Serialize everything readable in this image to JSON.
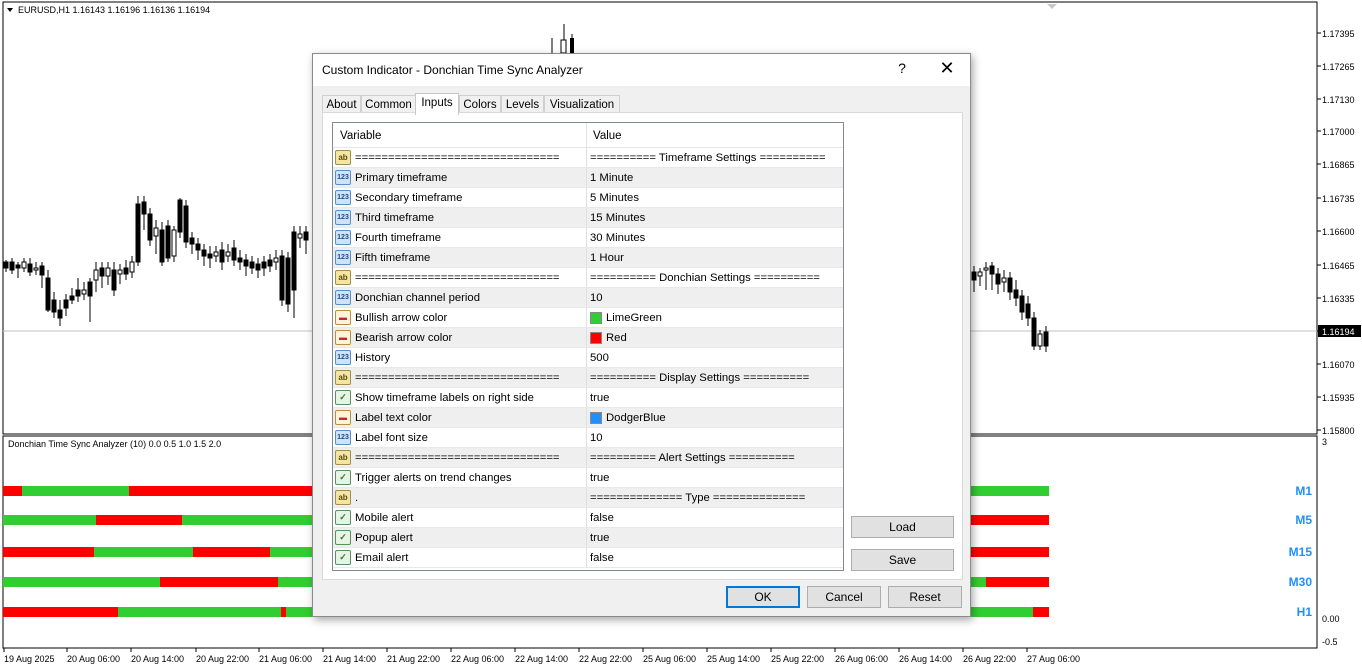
{
  "chart": {
    "symbol_info": "EURUSD,H1  1.16143 1.16196 1.16136 1.16194",
    "price_labels": [
      "1.17395",
      "1.17265",
      "1.17130",
      "1.17000",
      "1.16865",
      "1.16735",
      "1.16600",
      "1.16465",
      "1.16335",
      "1.16194",
      "1.16070",
      "1.15935",
      "1.15800"
    ],
    "current_price": "1.16194",
    "indicator_title": "Donchian Time Sync Analyzer (10) 0.0 0.5 1.0 1.5 2.0",
    "indicator_scale": [
      "3",
      "0.00",
      "-0.5"
    ],
    "timeframe_labels": [
      "M1",
      "M5",
      "M15",
      "M30",
      "H1"
    ],
    "time_labels": [
      "19 Aug 2025",
      "20 Aug 06:00",
      "20 Aug 14:00",
      "20 Aug 22:00",
      "21 Aug 06:00",
      "21 Aug 14:00",
      "21 Aug 22:00",
      "22 Aug 06:00",
      "22 Aug 14:00",
      "22 Aug 22:00",
      "25 Aug 06:00",
      "25 Aug 14:00",
      "25 Aug 22:00",
      "26 Aug 06:00",
      "26 Aug 14:00",
      "26 Aug 22:00",
      "27 Aug 06:00"
    ],
    "colors": {
      "bull": "#32cd32",
      "bear": "#ff0000",
      "label": "#1e90ff"
    }
  },
  "dialog": {
    "title": "Custom Indicator - Donchian Time Sync Analyzer",
    "help": "?",
    "close": "✕",
    "tabs": [
      "About",
      "Common",
      "Inputs",
      "Colors",
      "Levels",
      "Visualization"
    ],
    "active_tab": "Inputs",
    "columns": {
      "variable": "Variable",
      "value": "Value"
    },
    "rows": [
      {
        "icon": "ab",
        "var": "===============================",
        "val": "========== Timeframe Settings =========="
      },
      {
        "icon": "123",
        "var": "Primary timeframe",
        "val": "1 Minute"
      },
      {
        "icon": "123",
        "var": "Secondary timeframe",
        "val": "5 Minutes"
      },
      {
        "icon": "123",
        "var": "Third timeframe",
        "val": "15 Minutes"
      },
      {
        "icon": "123",
        "var": "Fourth timeframe",
        "val": "30 Minutes"
      },
      {
        "icon": "123",
        "var": "Fifth timeframe",
        "val": "1 Hour"
      },
      {
        "icon": "ab",
        "var": "===============================",
        "val": "========== Donchian Settings =========="
      },
      {
        "icon": "123",
        "var": "Donchian channel period",
        "val": "10"
      },
      {
        "icon": "clr",
        "var": "Bullish arrow color",
        "val": "LimeGreen",
        "swatch": "#32cd32"
      },
      {
        "icon": "clr",
        "var": "Bearish arrow color",
        "val": "Red",
        "swatch": "#ff0000"
      },
      {
        "icon": "123",
        "var": "History",
        "val": "500"
      },
      {
        "icon": "ab",
        "var": "===============================",
        "val": "========== Display Settings =========="
      },
      {
        "icon": "bool",
        "var": "Show timeframe labels on right side",
        "val": "true"
      },
      {
        "icon": "clr",
        "var": "Label text color",
        "val": "DodgerBlue",
        "swatch": "#1e90ff"
      },
      {
        "icon": "123",
        "var": "Label font size",
        "val": "10"
      },
      {
        "icon": "ab",
        "var": "===============================",
        "val": "========== Alert Settings =========="
      },
      {
        "icon": "bool",
        "var": "Trigger alerts on trend changes",
        "val": "true"
      },
      {
        "icon": "ab",
        "var": ".",
        "val": "============== Type =============="
      },
      {
        "icon": "bool",
        "var": "Mobile alert",
        "val": "false"
      },
      {
        "icon": "bool",
        "var": "Popup alert",
        "val": "true"
      },
      {
        "icon": "bool",
        "var": "Email alert",
        "val": "false"
      }
    ],
    "side_buttons": {
      "load": "Load",
      "save": "Save"
    },
    "buttons": {
      "ok": "OK",
      "cancel": "Cancel",
      "reset": "Reset"
    }
  }
}
